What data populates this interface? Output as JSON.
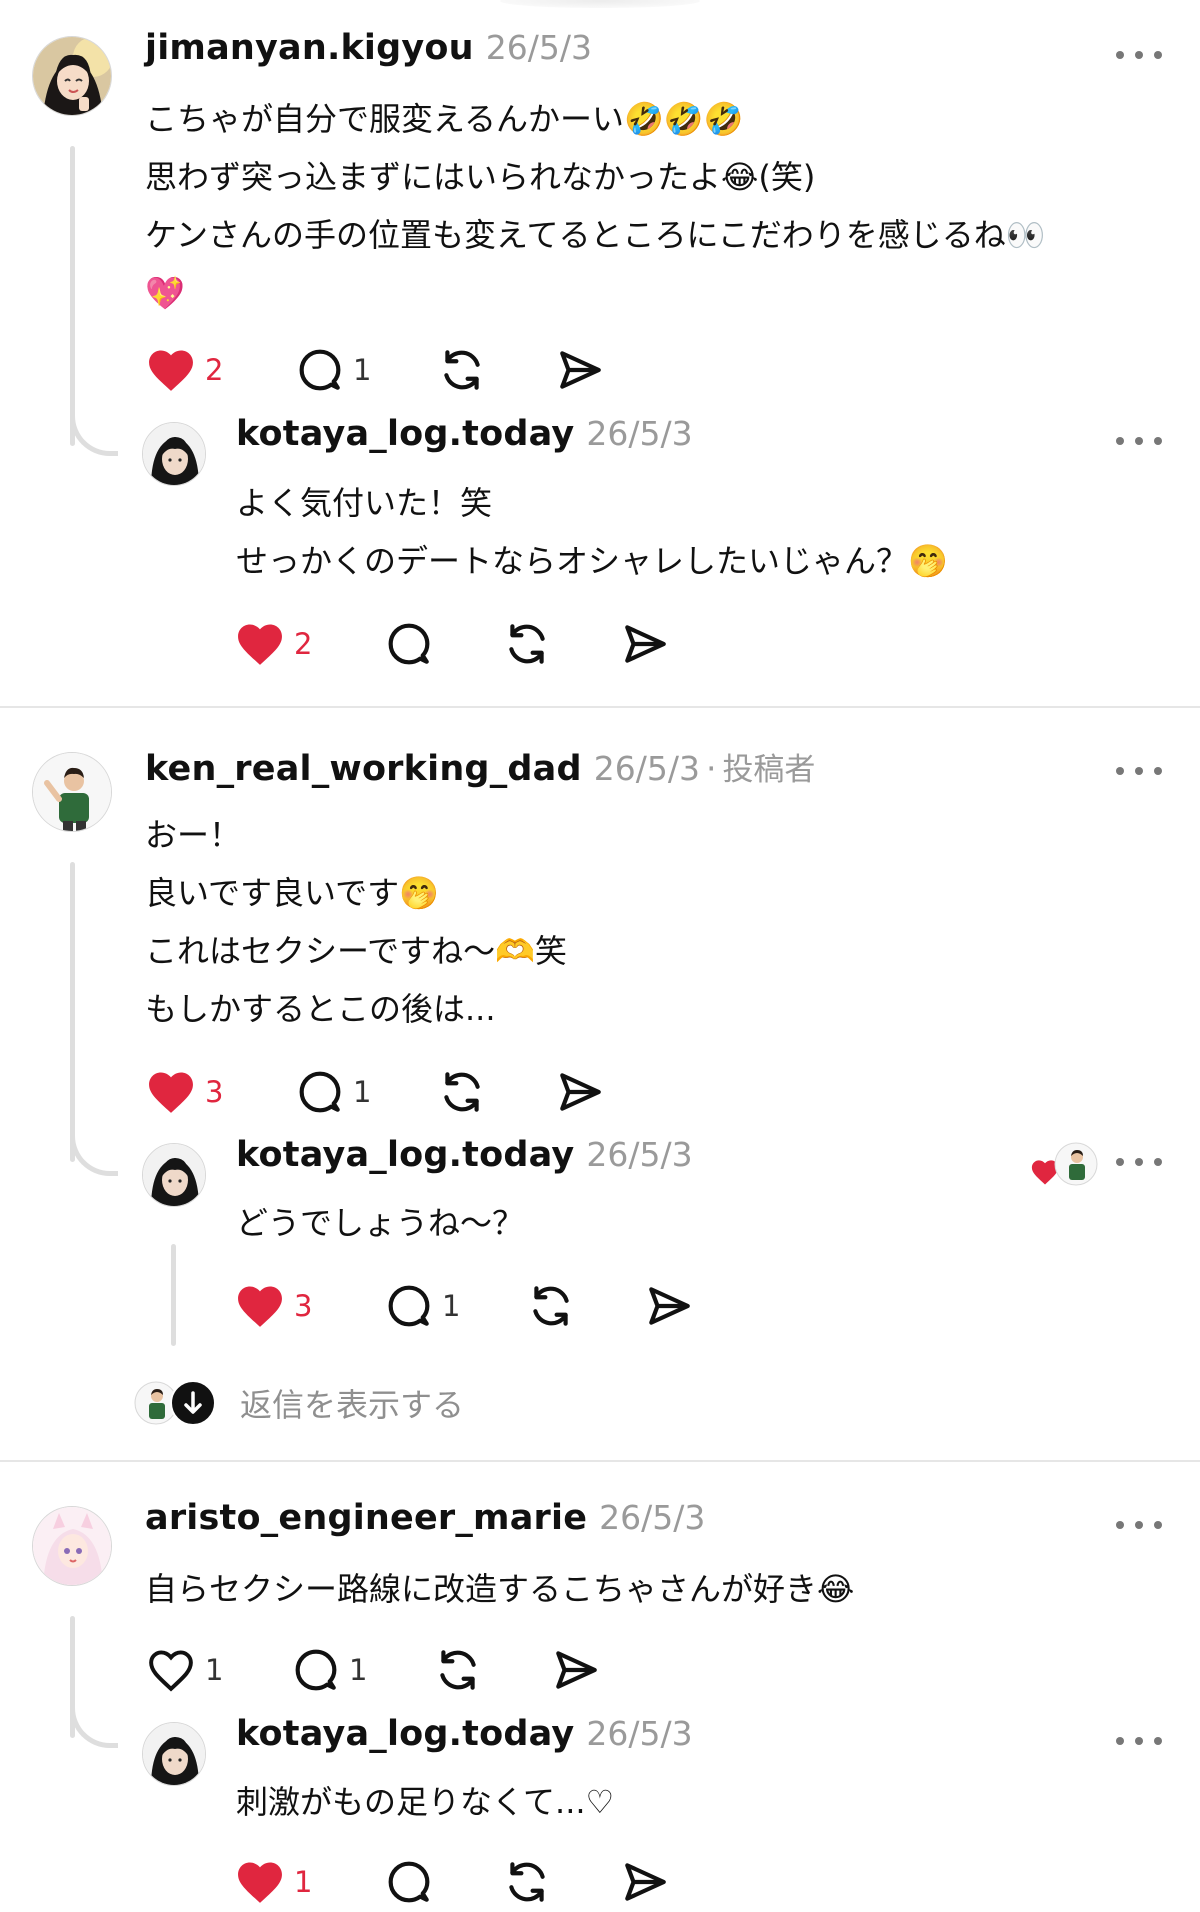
{
  "threads": [
    {
      "comment": {
        "username": "jimanyan.kigyou",
        "date": "26/5/3",
        "lines": [
          "こちゃが自分で服変えるんかーい🤣🤣🤣",
          "思わず突っ込まずにはいられなかったよ😂(笑)",
          "ケンさんの手の位置も変えてるところにこだわりを感じるね👀",
          "💖"
        ],
        "like_count": "2",
        "reply_count": "1"
      },
      "reply": {
        "username": "kotaya_log.today",
        "date": "26/5/3",
        "lines": [
          "よく気付いた！笑",
          "せっかくのデートならオシャレしたいじゃん？🤭"
        ],
        "like_count": "2",
        "reply_count": ""
      }
    },
    {
      "comment": {
        "username": "ken_real_working_dad",
        "date": "26/5/3",
        "separator": "·",
        "author_tag": "投稿者",
        "lines": [
          "おー！",
          "良いです良いです🤭",
          "これはセクシーですね〜🫶笑",
          "もしかするとこの後は..."
        ],
        "like_count": "3",
        "reply_count": "1"
      },
      "reply": {
        "username": "kotaya_log.today",
        "date": "26/5/3",
        "lines": [
          "どうでしょうね〜？"
        ],
        "like_count": "3",
        "reply_count": "1"
      },
      "show_replies_label": "返信を表示する"
    },
    {
      "comment": {
        "username": "aristo_engineer_marie",
        "date": "26/5/3",
        "lines": [
          "自らセクシー路線に改造するこちゃさんが好き😂"
        ],
        "like_count": "1",
        "reply_count": "1"
      },
      "reply": {
        "username": "kotaya_log.today",
        "date": "26/5/3",
        "lines": [
          "刺激がもの足りなくて...♡"
        ],
        "like_count": "1",
        "reply_count": ""
      }
    }
  ],
  "colors": {
    "like": "#e0263f",
    "muted": "#9a9a9a",
    "line": "#dedede"
  },
  "icons": [
    "heart-icon",
    "comment-icon",
    "repost-icon",
    "share-icon",
    "more-icon",
    "arrow-down-icon"
  ]
}
